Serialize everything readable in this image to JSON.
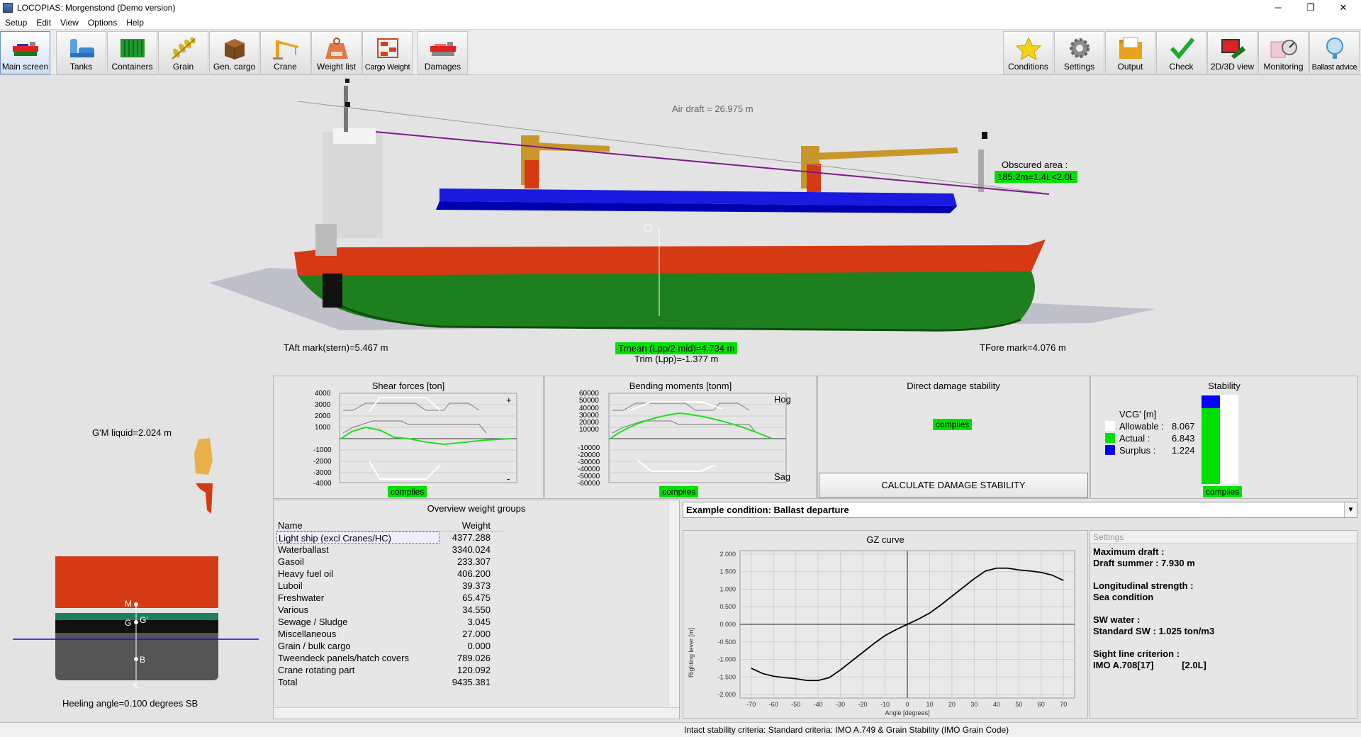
{
  "window": {
    "title": "LOCOPIAS: Morgenstond (Demo version)",
    "minimize": "─",
    "restore": "❐",
    "close": "✕"
  },
  "menu": [
    "Setup",
    "Edit",
    "View",
    "Options",
    "Help"
  ],
  "toolbar_left": [
    {
      "label": "Main screen",
      "icon": "ship-icon"
    },
    {
      "label": "Tanks",
      "icon": "tanks-icon"
    },
    {
      "label": "Containers",
      "icon": "containers-icon"
    },
    {
      "label": "Grain",
      "icon": "grain-icon"
    },
    {
      "label": "Gen. cargo",
      "icon": "cargo-box-icon"
    },
    {
      "label": "Crane",
      "icon": "crane-icon"
    },
    {
      "label": "Weight list",
      "icon": "weight-icon"
    },
    {
      "label": "Cargo Weight",
      "icon": "cargo-weight-icon"
    },
    {
      "label": "Damages",
      "icon": "damaged-ship-icon"
    }
  ],
  "toolbar_right": [
    {
      "label": "Conditions",
      "icon": "star-icon"
    },
    {
      "label": "Settings",
      "icon": "gear-icon"
    },
    {
      "label": "Output",
      "icon": "folder-icon"
    },
    {
      "label": "Check",
      "icon": "checkmark-icon"
    },
    {
      "label": "2D/3D view",
      "icon": "view-3d-icon"
    },
    {
      "label": "Monitoring",
      "icon": "monitoring-icon"
    },
    {
      "label": "Ballast advice",
      "icon": "ballast-advice-icon"
    }
  ],
  "ship_view": {
    "air_draft": "Air draft = 26.975 m",
    "obscured_label": "Obscured area :",
    "obscured_value": "185.2m=1.4L<2.0L",
    "aft_mark": "TAft mark(stern)=5.467 m",
    "tmean": "Tmean (Lpp/2 mid)=4.734 m",
    "trim": "Trim (Lpp)=-1.377 m",
    "fore_mark": "TFore mark=4.076 m"
  },
  "section_view": {
    "gm": "G'M liquid=2.024 m",
    "heeling": "Heeling angle=0.100 degrees SB",
    "points": {
      "m": "M",
      "g": "G",
      "g_prime": "G'",
      "b": "B",
      "k": "K"
    }
  },
  "shear": {
    "title": "Shear forces [ton]",
    "ticks": [
      "4000",
      "3000",
      "2000",
      "1000",
      "-1000",
      "-2000",
      "-3000",
      "-4000"
    ],
    "plus": "+",
    "minus": "-",
    "status": "complies"
  },
  "bending": {
    "title": "Bending moments [tonm]",
    "ticks": [
      "60000",
      "50000",
      "40000",
      "30000",
      "20000",
      "10000",
      "-10000",
      "-20000",
      "-30000",
      "-40000",
      "-50000",
      "-60000"
    ],
    "hog": "Hog",
    "sag": "Sag",
    "status": "complies"
  },
  "damage": {
    "title": "Direct damage stability",
    "status": "complies",
    "button": "CALCULATE DAMAGE STABILITY"
  },
  "stability": {
    "title": "Stability",
    "header": "VCG' [m]",
    "allowable_label": "Allowable :",
    "allowable": "8.067",
    "actual_label": "Actual :",
    "actual": "6.843",
    "surplus_label": "Surplus :",
    "surplus": "1.224",
    "status": "complies",
    "colors": {
      "allowable": "#ffffff",
      "actual": "#00e000",
      "surplus": "#0000ff"
    }
  },
  "weights": {
    "title": "Overview weight groups",
    "col_name": "Name",
    "col_weight": "Weight",
    "rows": [
      {
        "name": "Light ship (excl Cranes/HC)",
        "weight": "4377.288"
      },
      {
        "name": "Waterballast",
        "weight": "3340.024"
      },
      {
        "name": "Gasoil",
        "weight": "233.307"
      },
      {
        "name": "Heavy fuel oil",
        "weight": "406.200"
      },
      {
        "name": "Luboil",
        "weight": "39.373"
      },
      {
        "name": "Freshwater",
        "weight": "65.475"
      },
      {
        "name": "Various",
        "weight": "34.550"
      },
      {
        "name": "Sewage / Sludge",
        "weight": "3.045"
      },
      {
        "name": "Miscellaneous",
        "weight": "27.000"
      },
      {
        "name": "Grain / bulk cargo",
        "weight": "0.000"
      },
      {
        "name": "Tweendeck panels/hatch covers",
        "weight": "789.026"
      },
      {
        "name": "Crane rotating part",
        "weight": "120.092"
      },
      {
        "name": "Total",
        "weight": "9435.381"
      }
    ]
  },
  "condition": {
    "selected": "Example condition: Ballast departure",
    "arrow": "▼"
  },
  "chart_data": {
    "type": "line",
    "title": "GZ curve",
    "xlabel": "Angle [degrees]",
    "ylabel": "Righting lever [m]",
    "xlim": [
      -75,
      75
    ],
    "ylim": [
      -2.1,
      2.1
    ],
    "x_ticks": [
      -70,
      -60,
      -50,
      -40,
      -30,
      -20,
      -10,
      0,
      10,
      20,
      30,
      40,
      50,
      60,
      70
    ],
    "y_ticks": [
      "2.000",
      "1.500",
      "1.000",
      "0.500",
      "0.000",
      "-0.500",
      "-1.000",
      "-1.500",
      "-2.000"
    ],
    "grid": true,
    "x": [
      -70,
      -65,
      -60,
      -55,
      -50,
      -45,
      -40,
      -35,
      -30,
      -25,
      -20,
      -15,
      -10,
      -5,
      0,
      5,
      10,
      15,
      20,
      25,
      30,
      35,
      40,
      45,
      50,
      55,
      60,
      65,
      70
    ],
    "y": [
      -1.25,
      -1.4,
      -1.48,
      -1.52,
      -1.55,
      -1.6,
      -1.6,
      -1.52,
      -1.3,
      -1.05,
      -0.8,
      -0.55,
      -0.32,
      -0.15,
      0.0,
      0.15,
      0.32,
      0.55,
      0.8,
      1.05,
      1.3,
      1.52,
      1.6,
      1.6,
      1.55,
      1.52,
      1.48,
      1.4,
      1.25
    ]
  },
  "settings_box": {
    "header": "Settings",
    "lines": [
      "Maximum draft :",
      "Draft summer : 7.930 m",
      "",
      "Longitudinal strength :",
      "Sea condition",
      "",
      "SW water :",
      "Standard SW : 1.025 ton/m3",
      "",
      "Sight line criterion :",
      "IMO A.708[17]           [2.0L]"
    ]
  },
  "status_bar": "Intact stability criteria: Standard criteria: IMO A.749 & Grain Stability (IMO Grain Code)"
}
